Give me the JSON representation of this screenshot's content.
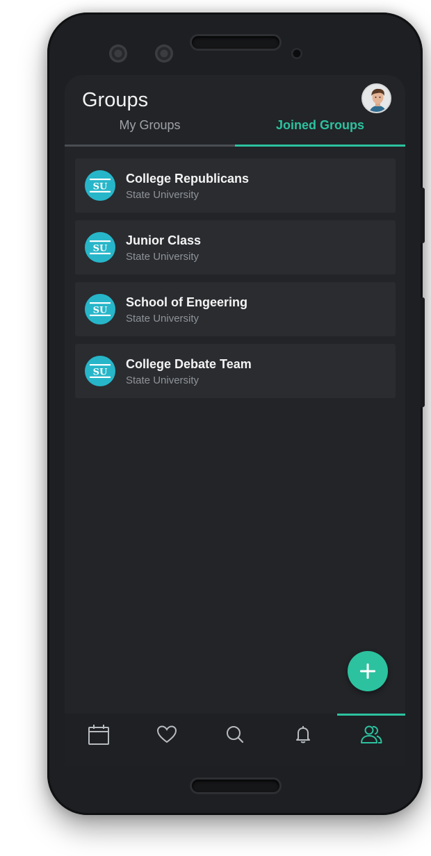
{
  "header": {
    "title": "Groups"
  },
  "tabs": [
    {
      "label": "My Groups",
      "active": false
    },
    {
      "label": "Joined Groups",
      "active": true
    }
  ],
  "groups": [
    {
      "name": "College Republicans",
      "school": "State University",
      "logo_text": "SU"
    },
    {
      "name": "Junior Class",
      "school": "State University",
      "logo_text": "SU"
    },
    {
      "name": "School of Engeering",
      "school": "State University",
      "logo_text": "SU"
    },
    {
      "name": "College Debate Team",
      "school": "State University",
      "logo_text": "SU"
    }
  ],
  "bottom_nav": [
    {
      "icon": "calendar-icon",
      "active": false
    },
    {
      "icon": "heart-icon",
      "active": false
    },
    {
      "icon": "search-icon",
      "active": false
    },
    {
      "icon": "bell-icon",
      "active": false
    },
    {
      "icon": "groups-icon",
      "active": true
    }
  ],
  "colors": {
    "accent": "#2cc29f",
    "background": "#222428",
    "card": "#2a2c30",
    "logo": "#27b6c9"
  }
}
